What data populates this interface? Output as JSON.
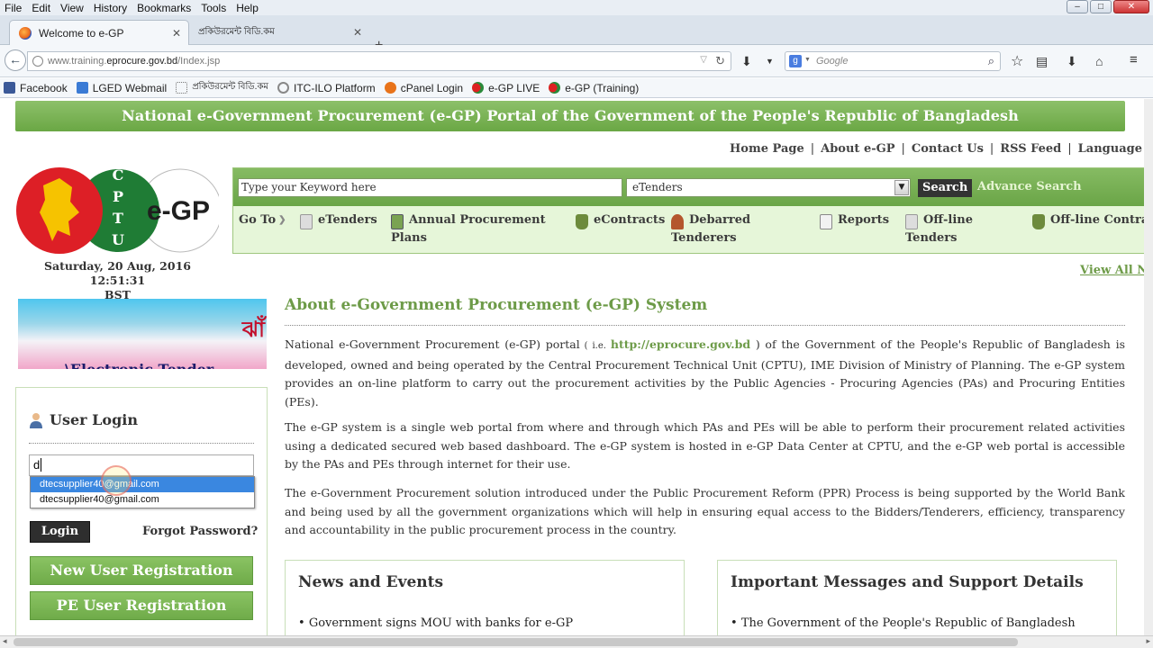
{
  "browser": {
    "menu": [
      "File",
      "Edit",
      "View",
      "History",
      "Bookmarks",
      "Tools",
      "Help"
    ],
    "tabs": [
      {
        "label": "Welcome to e-GP",
        "active": true
      },
      {
        "label": "প্রকিউরমেন্ট বিডি.কম",
        "active": false
      }
    ],
    "url_prefix": "www.training.",
    "url_domain": "eprocure.gov.bd",
    "url_path": "/Index.jsp",
    "search_placeholder": "Google",
    "bookmarks": [
      "Facebook",
      "LGED Webmail",
      "প্রকিউরমেন্ট বিডি.কম",
      "ITC-ILO Platform",
      "cPanel Login",
      "e-GP LIVE",
      "e-GP (Training)"
    ]
  },
  "page": {
    "banner": "National e-Government Procurement (e-GP) Portal of the Government of the People's Republic of Bangladesh",
    "top_links": [
      "Home Page",
      "About e-GP",
      "Contact Us",
      "RSS Feed",
      "Language"
    ],
    "logo": {
      "cptu": "CPTU",
      "egp": "e-GP"
    },
    "date_line1": "Saturday, 20 Aug, 2016 12:51:31",
    "date_line2": "BST",
    "search": {
      "keyword_placeholder": "Type your Keyword here",
      "category": "eTenders",
      "search_button": "Search",
      "advance_search": "Advance Search"
    },
    "goto": {
      "label": "Go To",
      "items": [
        {
          "label": "eTenders",
          "label2": ""
        },
        {
          "label": "Annual Procurement",
          "label2": "Plans"
        },
        {
          "label": "eContracts",
          "label2": ""
        },
        {
          "label": "Debarred",
          "label2": "Tenderers"
        },
        {
          "label": "Reports",
          "label2": ""
        },
        {
          "label": "Off-line",
          "label2": "Tenders"
        },
        {
          "label": "Off-line Contra",
          "label2": ""
        }
      ]
    },
    "view_all": "View All N",
    "tender_banner": {
      "bangla": "ঝাঁ",
      "text": "\\Electronic Tender"
    },
    "login": {
      "title": "User Login",
      "input_value": "d",
      "suggestions": [
        "dtecsupplier40@gmail.com",
        "dtecsupplier40@gmail.com"
      ],
      "login_button": "Login",
      "forgot": "Forgot Password?",
      "new_user": "New User Registration",
      "pe_user": "PE User Registration"
    },
    "about": {
      "title": "About e-Government Procurement (e-GP) System",
      "p1_a": "National e-Government Procurement (e-GP) portal",
      "p1_ie": " ( i.e. ",
      "p1_link": "http://eprocure.gov.bd",
      "p1_b": " ) of the Government of the People's Republic of Bangladesh is developed, owned and being operated by the Central Procurement Technical Unit (CPTU), IME Division of Ministry of Planning. The e-GP system provides an on-line platform to carry out the procurement activities by the Public Agencies - Procuring Agencies (PAs) and Procuring Entities (PEs).",
      "p2": "The e-GP system is a single web portal from where and through which PAs and PEs will be able to perform their procurement related activities using a dedicated secured web based dashboard. The e-GP system is hosted in e-GP Data Center at CPTU, and the e-GP web portal is accessible by the PAs and PEs through internet for their use.",
      "p3": "The e-Government Procurement solution introduced under the Public Procurement Reform (PPR) Process is being supported by the World Bank and being used by all the government organizations which will help in ensuring equal access to the Bidders/Tenderers, efficiency, transparency and accountability in the public procurement process in the country."
    },
    "news": {
      "title": "News and Events",
      "item": "Government signs MOU with banks for e-GP"
    },
    "messages": {
      "title": "Important Messages and Support Details",
      "item": "The Government of the People's Republic of Bangladesh"
    }
  },
  "colors": {
    "accent_green": "#6aa744",
    "link_green": "#6d9b48",
    "highlight_blue": "#3a87e0"
  }
}
